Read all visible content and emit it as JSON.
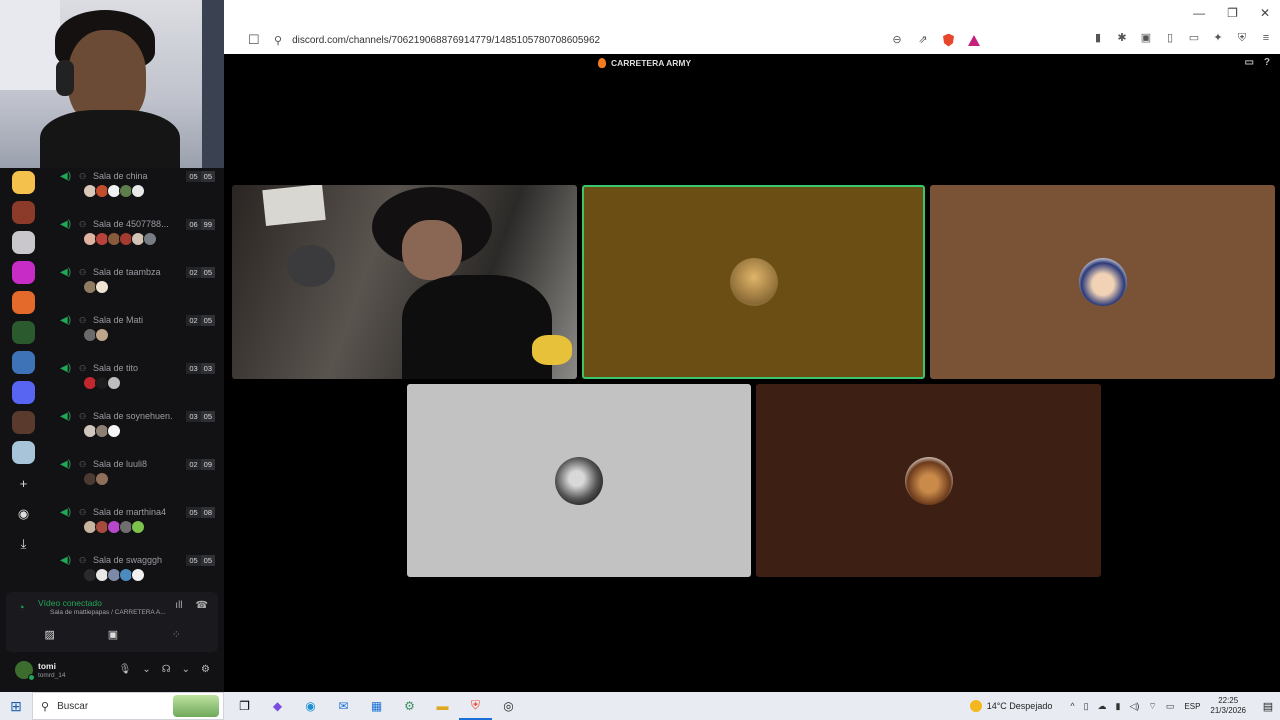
{
  "browser": {
    "url": "discord.com/channels/706219068876914779/1485105780708605962",
    "window_controls": [
      "—",
      "❐",
      "✕"
    ]
  },
  "discord_topbar": {
    "server_title": "CARRETERA ARMY"
  },
  "voice_channels": [
    {
      "name": "Sala de china",
      "count_a": "05",
      "count_b": "05",
      "avatar_colors": [
        "#d9c7b8",
        "#c24d2c",
        "#f1f1f1",
        "#5d7e4b",
        "#e8e8e8"
      ]
    },
    {
      "name": "Sala de 4507788...",
      "count_a": "06",
      "count_b": "99",
      "avatar_colors": [
        "#e0b3a0",
        "#b9433a",
        "#8a5a3c",
        "#a53a2f",
        "#d1c3b5",
        "#777c85"
      ]
    },
    {
      "name": "Sala de taambza",
      "count_a": "02",
      "count_b": "05",
      "avatar_colors": [
        "#8f7a62",
        "#efe4d1"
      ]
    },
    {
      "name": "Sala de Mati",
      "count_a": "02",
      "count_b": "05",
      "avatar_colors": [
        "#6a6a6a",
        "#bfa58a"
      ]
    },
    {
      "name": "Sala de tito",
      "count_a": "03",
      "count_b": "03",
      "avatar_colors": [
        "#c2272d",
        "#1c1c1c",
        "#bdbdbd"
      ]
    },
    {
      "name": "Sala de soynehuen.",
      "count_a": "03",
      "count_b": "05",
      "avatar_colors": [
        "#cfc6bd",
        "#8c7f74",
        "#f5f5f5"
      ]
    },
    {
      "name": "Sala de luuli8",
      "count_a": "02",
      "count_b": "09",
      "avatar_colors": [
        "#4b3a31",
        "#8f6f5c"
      ]
    },
    {
      "name": "Sala de marthina4",
      "count_a": "05",
      "count_b": "08",
      "avatar_colors": [
        "#c8b59f",
        "#a64b3d",
        "#b648c9",
        "#6f6f6f",
        "#7dc24a"
      ]
    },
    {
      "name": "Sala de swagggh",
      "count_a": "05",
      "count_b": "05",
      "avatar_colors": [
        "#2a2a2a",
        "#e7e7e7",
        "#7c8aa8",
        "#4b8bbf",
        "#f0f0f0"
      ]
    }
  ],
  "servers": [
    {
      "color": "#f4c14d"
    },
    {
      "color": "#8c3a2a"
    },
    {
      "color": "#c9c6cc"
    },
    {
      "color": "#c72cc7"
    },
    {
      "color": "#e36a2a"
    },
    {
      "color": "#2b5a2f"
    },
    {
      "color": "#3f73b8"
    },
    {
      "color": "#5865f2"
    },
    {
      "color": "#5a3a2c"
    },
    {
      "color": "#a8c4d8"
    }
  ],
  "rail_actions": {
    "add": "+",
    "discover": "◉",
    "download": "⤓"
  },
  "voice_panel": {
    "status": "Vídeo conectado",
    "subtitle": "Sala de mattiepapas / CARRETERA A..."
  },
  "user": {
    "name": "tomi",
    "tag": "tomrd_14"
  },
  "taskbar": {
    "search_placeholder": "Buscar",
    "weather": "14°C  Despejado",
    "lang": "ESP",
    "time": "22:25",
    "date": "21/3/2026"
  }
}
